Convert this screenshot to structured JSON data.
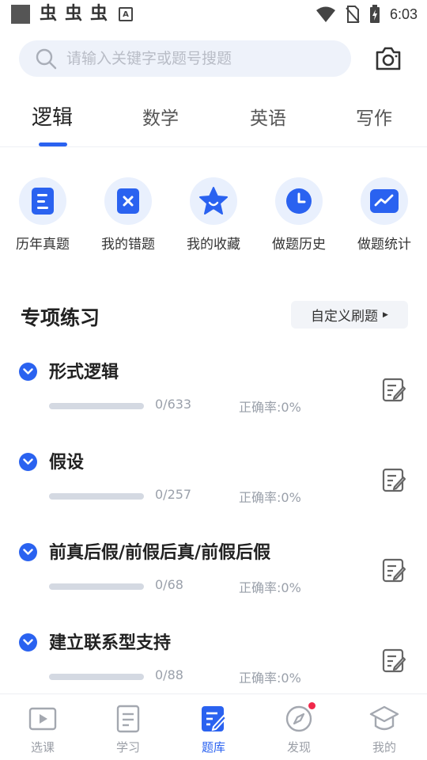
{
  "status_bar": {
    "time": "6:03",
    "bug_glyphs": [
      "虫",
      "虫",
      "虫"
    ],
    "a_badge": "A"
  },
  "search": {
    "placeholder": "请输入关键字或题号搜题",
    "value": ""
  },
  "tabs": [
    {
      "label": "逻辑",
      "active": true
    },
    {
      "label": "数学",
      "active": false
    },
    {
      "label": "英语",
      "active": false
    },
    {
      "label": "写作",
      "active": false
    }
  ],
  "quick_entries": [
    {
      "label": "历年真题",
      "icon": "document-list-icon"
    },
    {
      "label": "我的错题",
      "icon": "wrong-x-icon"
    },
    {
      "label": "我的收藏",
      "icon": "star-icon"
    },
    {
      "label": "做题历史",
      "icon": "clock-icon"
    },
    {
      "label": "做题统计",
      "icon": "trend-chart-icon"
    }
  ],
  "section": {
    "title": "专项练习",
    "custom_label": "自定义刷题"
  },
  "practice_items": [
    {
      "title": "形式逻辑",
      "count": "0/633",
      "accuracy": "正确率:0%",
      "progress": 0
    },
    {
      "title": "假设",
      "count": "0/257",
      "accuracy": "正确率:0%",
      "progress": 0
    },
    {
      "title": "前真后假/前假后真/前假后假",
      "count": "0/68",
      "accuracy": "正确率:0%",
      "progress": 0
    },
    {
      "title": "建立联系型支持",
      "count": "0/88",
      "accuracy": "正确率:0%",
      "progress": 0
    }
  ],
  "bottom_nav": [
    {
      "label": "选课",
      "icon": "play-video-icon",
      "active": false
    },
    {
      "label": "学习",
      "icon": "book-icon",
      "active": false
    },
    {
      "label": "题库",
      "icon": "question-bank-icon",
      "active": true
    },
    {
      "label": "发现",
      "icon": "compass-icon",
      "active": false,
      "badge_dot": true
    },
    {
      "label": "我的",
      "icon": "graduation-cap-icon",
      "active": false
    }
  ],
  "colors": {
    "accent": "#2a62f0",
    "badge": "#f0284a",
    "muted_text": "#9aa0aa"
  }
}
